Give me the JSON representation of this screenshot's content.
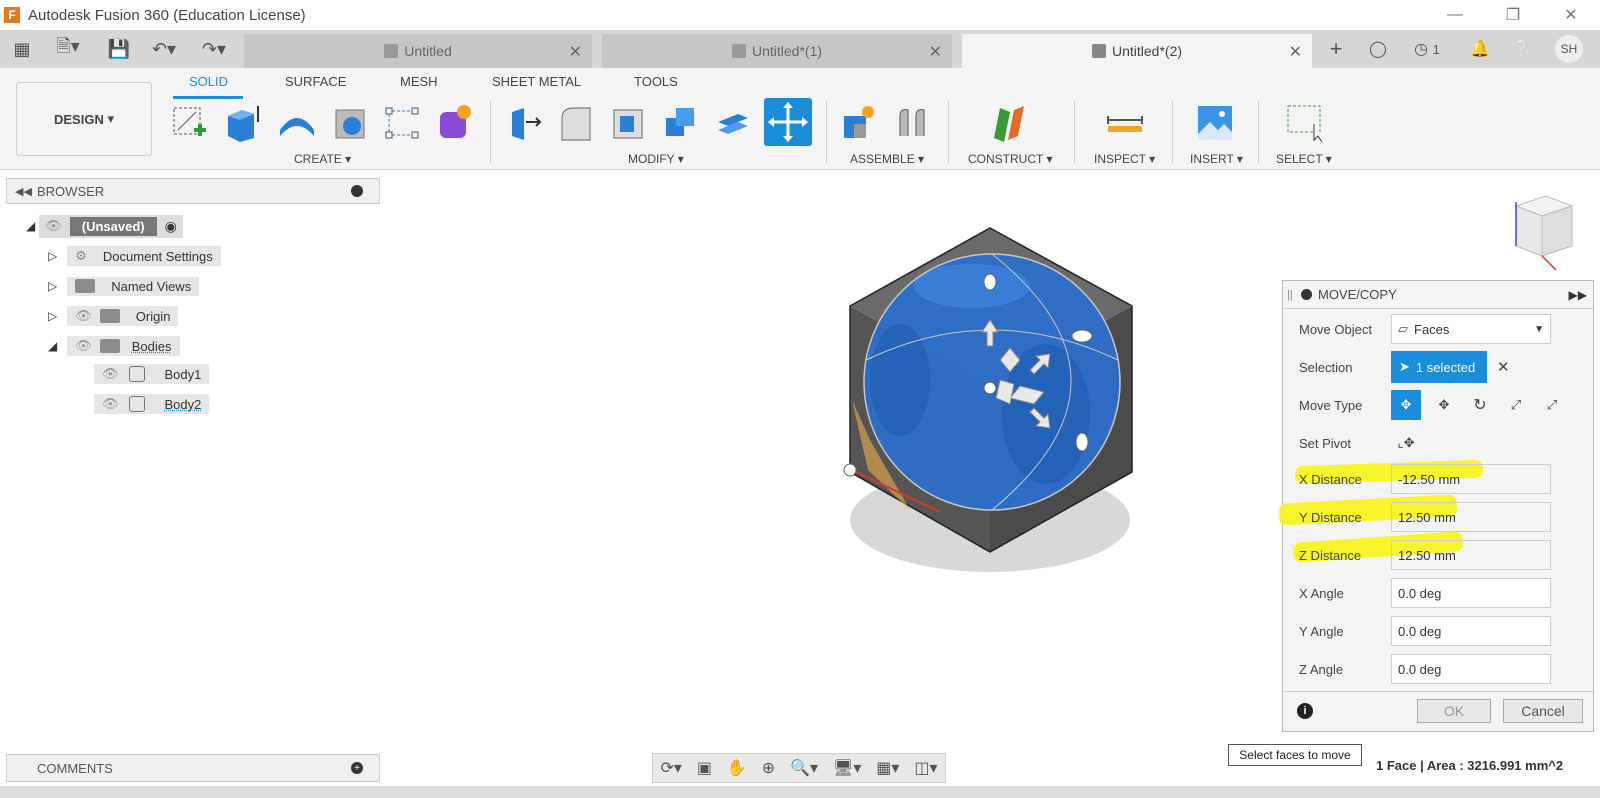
{
  "window": {
    "title": "Autodesk Fusion 360 (Education License)",
    "app_icon": "F"
  },
  "tabs": [
    {
      "label": "Untitled",
      "active": false
    },
    {
      "label": "Untitled*(1)",
      "active": false
    },
    {
      "label": "Untitled*(2)",
      "active": true
    }
  ],
  "header_right": {
    "job_count": "1",
    "user_initials": "SH"
  },
  "ribbon": {
    "workspace": "DESIGN",
    "tabs": [
      "SOLID",
      "SURFACE",
      "MESH",
      "SHEET METAL",
      "TOOLS"
    ],
    "groups": [
      "CREATE",
      "MODIFY",
      "ASSEMBLE",
      "CONSTRUCT",
      "INSPECT",
      "INSERT",
      "SELECT"
    ]
  },
  "browser": {
    "title": "BROWSER",
    "root": "(Unsaved)",
    "items": [
      "Document Settings",
      "Named Views",
      "Origin",
      "Bodies"
    ],
    "bodies": [
      "Body1",
      "Body2"
    ]
  },
  "dialog": {
    "title": "MOVE/COPY",
    "move_object_label": "Move Object",
    "move_object_value": "Faces",
    "selection_label": "Selection",
    "selection_value": "1 selected",
    "move_type_label": "Move Type",
    "set_pivot_label": "Set Pivot",
    "fields": [
      {
        "label": "X Distance",
        "value": "-12.50 mm"
      },
      {
        "label": "Y Distance",
        "value": "12.50 mm"
      },
      {
        "label": "Z Distance",
        "value": "12.50 mm"
      },
      {
        "label": "X Angle",
        "value": "0.0 deg"
      },
      {
        "label": "Y Angle",
        "value": "0.0 deg"
      },
      {
        "label": "Z Angle",
        "value": "0.0 deg"
      }
    ],
    "ok": "OK",
    "cancel": "Cancel"
  },
  "comments": {
    "title": "COMMENTS"
  },
  "tooltip": "Select faces to move",
  "status": "1 Face | Area : 3216.991 mm^2",
  "colors": {
    "accent": "#1a8ddb",
    "highlight": "#f7f31a",
    "body": "#2d6ec9",
    "cube": "#5b5b5b"
  }
}
